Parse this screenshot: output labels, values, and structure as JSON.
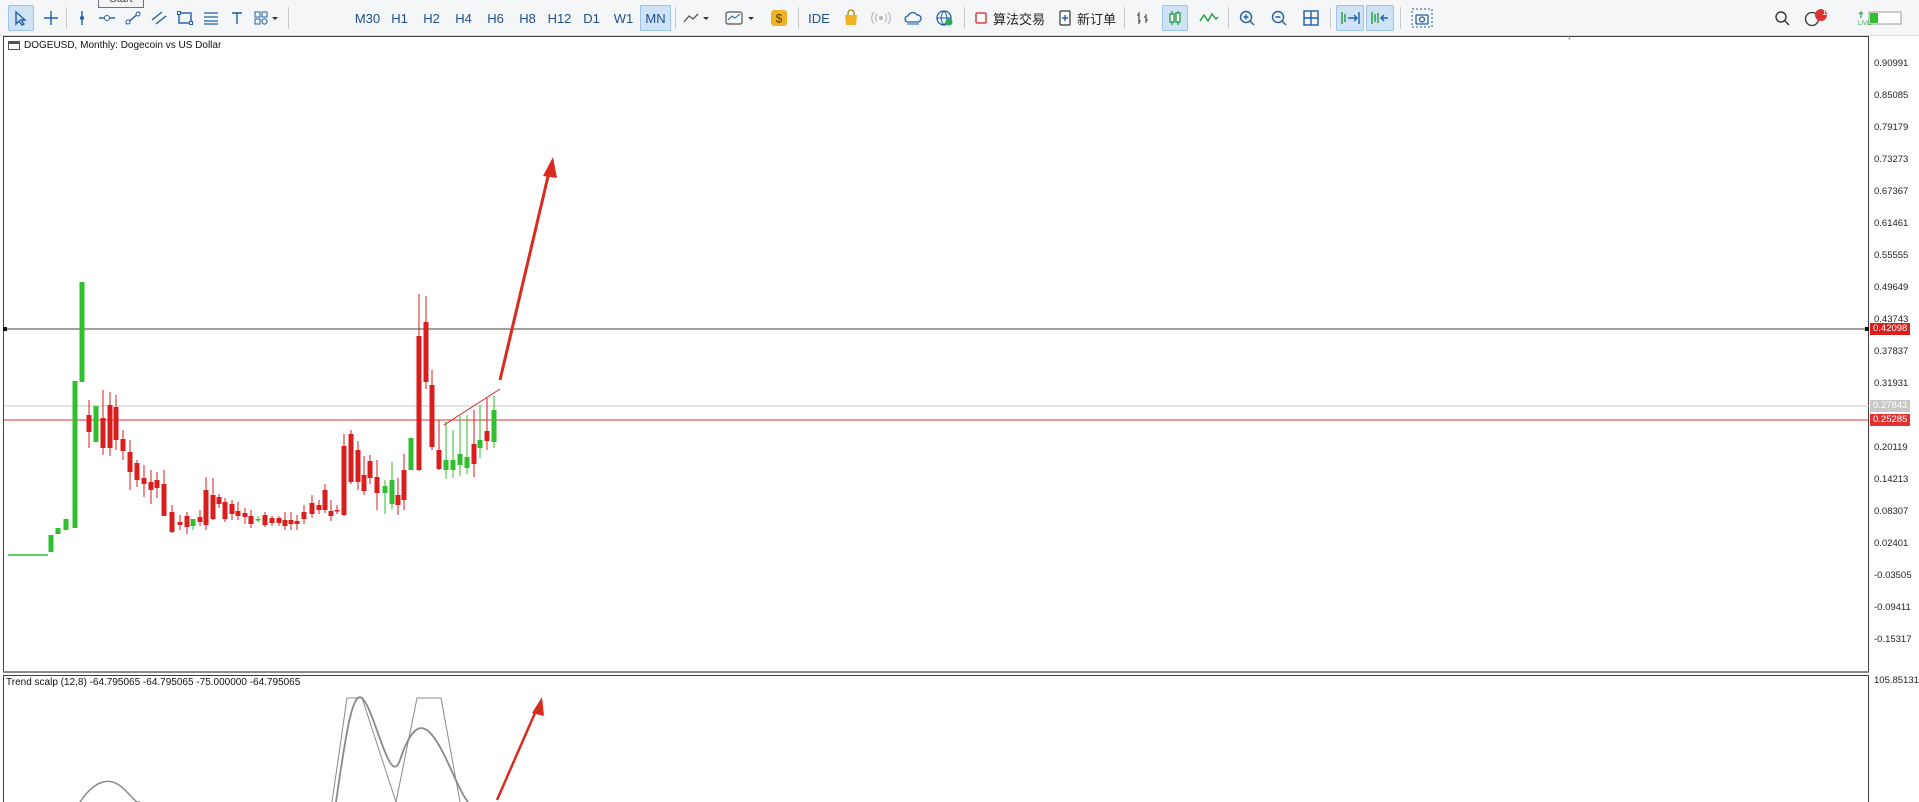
{
  "toolbar": {
    "tooltip": "Start",
    "timeframes": [
      "M30",
      "H1",
      "H2",
      "H4",
      "H6",
      "H8",
      "H12",
      "D1",
      "W1",
      "MN"
    ],
    "active_timeframe": "MN",
    "ide_label": "IDE",
    "algo_trading_label": "算法交易",
    "new_order_label": "新订单",
    "notification_count": "1"
  },
  "chart": {
    "title": "DOGEUSD, Monthly:  Dogecoin vs US Dollar",
    "price_axis": [
      "0.90991",
      "0.85085",
      "0.79179",
      "0.73273",
      "0.67367",
      "0.61461",
      "0.55555",
      "0.49649",
      "0.43743",
      "0.37837",
      "0.31931",
      "0.20119",
      "0.14213",
      "0.08307",
      "0.02401",
      "-0.03505",
      "-0.09411",
      "-0.15317"
    ],
    "price_badges": {
      "hline_black": "0.42098",
      "hline_gray": "0.27843",
      "hline_red": "0.25285"
    },
    "colors": {
      "bull": "#2fbf2f",
      "bear": "#d91e1e",
      "arrow": "#d92b20",
      "hline_red": "#e53030"
    }
  },
  "indicator": {
    "title": "Trend scalp (12,8) -64.795065 -64.795065 -75.000000 -64.795065",
    "axis_label": "105.851310"
  }
}
